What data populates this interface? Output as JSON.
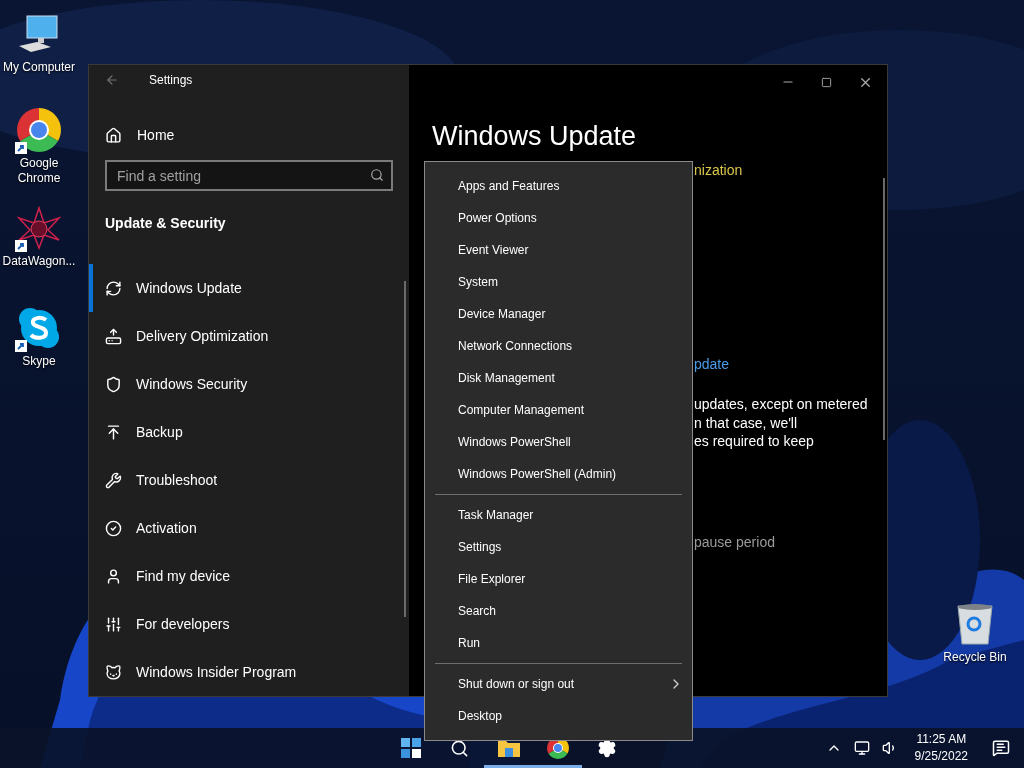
{
  "desktop_icons": [
    {
      "label": "My Computer",
      "shortcut": false
    },
    {
      "label": "Google Chrome",
      "shortcut": true
    },
    {
      "label": "DataWagon...",
      "shortcut": true
    },
    {
      "label": "Skype",
      "shortcut": true
    },
    {
      "label": "Recycle Bin",
      "shortcut": false
    }
  ],
  "settings_window": {
    "title": "Settings",
    "home": "Home",
    "search": {
      "placeholder": "Find a setting"
    },
    "section": "Update & Security",
    "nav": [
      {
        "label": "Windows Update",
        "selected": true
      },
      {
        "label": "Delivery Optimization",
        "selected": false
      },
      {
        "label": "Windows Security",
        "selected": false
      },
      {
        "label": "Backup",
        "selected": false
      },
      {
        "label": "Troubleshoot",
        "selected": false
      },
      {
        "label": "Activation",
        "selected": false
      },
      {
        "label": "Find my device",
        "selected": false
      },
      {
        "label": "For developers",
        "selected": false
      },
      {
        "label": "Windows Insider Program",
        "selected": false
      }
    ],
    "page_title": "Windows Update",
    "content_fragments": [
      {
        "text": "nization",
        "kind": "warning"
      },
      {
        "text": "pdate",
        "kind": "link"
      },
      {
        "text": "updates, except on metered",
        "kind": "body"
      },
      {
        "text": "n that case, we'll",
        "kind": "body"
      },
      {
        "text": "es required to keep",
        "kind": "body"
      },
      {
        "text": "pause period",
        "kind": "muted"
      }
    ]
  },
  "context_menu": {
    "groups": [
      [
        {
          "label": "Apps and Features",
          "submenu": false
        },
        {
          "label": "Power Options",
          "submenu": false
        },
        {
          "label": "Event Viewer",
          "submenu": false
        },
        {
          "label": "System",
          "submenu": false
        },
        {
          "label": "Device Manager",
          "submenu": false
        },
        {
          "label": "Network Connections",
          "submenu": false
        },
        {
          "label": "Disk Management",
          "submenu": false
        },
        {
          "label": "Computer Management",
          "submenu": false
        },
        {
          "label": "Windows PowerShell",
          "submenu": false
        },
        {
          "label": "Windows PowerShell (Admin)",
          "submenu": false
        }
      ],
      [
        {
          "label": "Task Manager",
          "submenu": false
        },
        {
          "label": "Settings",
          "submenu": false
        },
        {
          "label": "File Explorer",
          "submenu": false
        },
        {
          "label": "Search",
          "submenu": false
        },
        {
          "label": "Run",
          "submenu": false
        }
      ],
      [
        {
          "label": "Shut down or sign out",
          "submenu": true
        },
        {
          "label": "Desktop",
          "submenu": false
        }
      ]
    ]
  },
  "taskbar": {
    "apps": [
      {
        "running": false
      },
      {
        "running": false
      },
      {
        "running": true
      },
      {
        "running": true
      },
      {
        "running": false
      }
    ],
    "clock": {
      "time": "11:25 AM",
      "date": "9/25/2022"
    }
  }
}
